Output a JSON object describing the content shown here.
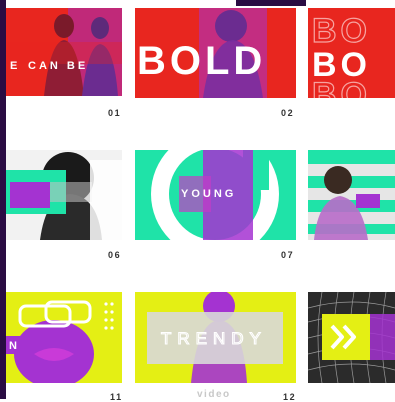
{
  "grid": {
    "row1": {
      "left_text": "CAN BE",
      "left_prefix": "E",
      "center_text": "BOLD",
      "right_text": "BO",
      "num_a": "01",
      "num_b": "02"
    },
    "row2": {
      "center_text": "YOUNG",
      "num_a": "06",
      "num_b": "07"
    },
    "row3": {
      "left_text": "N",
      "center_text": "TRENDY",
      "num_a": "11",
      "num_b": "12"
    }
  },
  "watermark": "video",
  "colors": {
    "red": "#e8261f",
    "purple": "#a433d1",
    "mint": "#1fe3a8",
    "yellow": "#e4ef14",
    "dark_edge": "#2a0c43"
  },
  "icons": [
    "chevron-right-icon",
    "dots-pattern-icon"
  ]
}
